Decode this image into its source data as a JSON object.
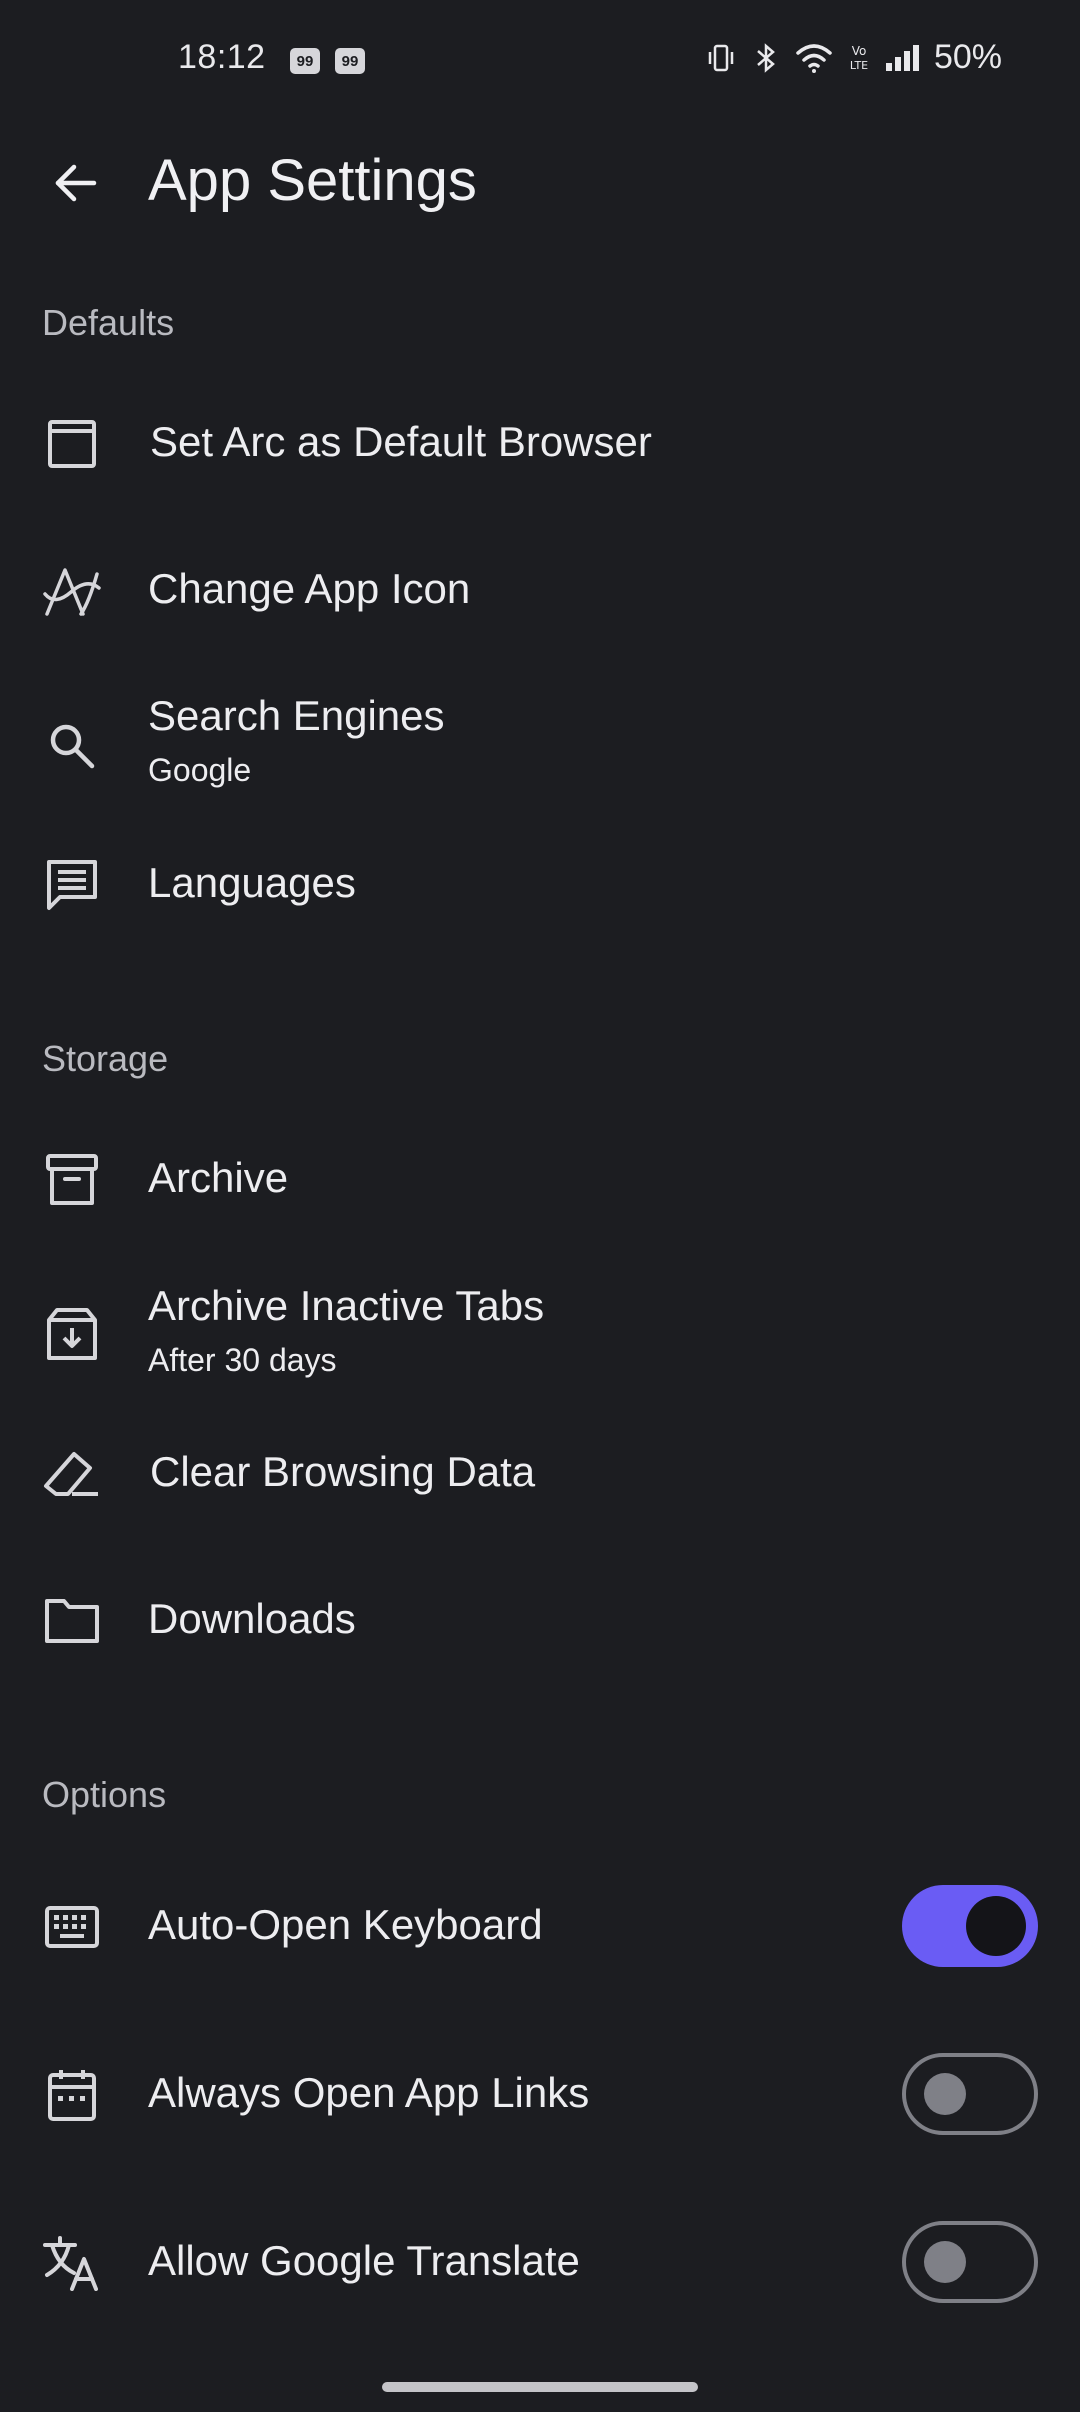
{
  "status_bar": {
    "time": "18:12",
    "notifications": [
      "99",
      "99"
    ],
    "icons": [
      "vibrate-icon",
      "bluetooth-icon",
      "wifi-icon",
      "volte-icon",
      "signal-icon"
    ],
    "volte_label": "Vo\nLTE",
    "battery": "50%"
  },
  "header": {
    "title": "App Settings",
    "back_icon": "back-arrow-icon"
  },
  "sections": {
    "defaults": {
      "title": "Defaults",
      "items": [
        {
          "label": "Set Arc as Default Browser",
          "icon": "browser-window-icon"
        },
        {
          "label": "Change App Icon",
          "icon": "arc-logo-icon"
        },
        {
          "label": "Search Engines",
          "sublabel": "Google",
          "icon": "search-icon"
        },
        {
          "label": "Languages",
          "icon": "message-icon"
        }
      ]
    },
    "storage": {
      "title": "Storage",
      "items": [
        {
          "label": "Archive",
          "icon": "archive-box-icon"
        },
        {
          "label": "Archive Inactive Tabs",
          "sublabel": "After 30 days",
          "icon": "archive-download-icon"
        },
        {
          "label": "Clear Browsing Data",
          "icon": "eraser-icon"
        },
        {
          "label": "Downloads",
          "icon": "folder-icon"
        }
      ]
    },
    "options": {
      "title": "Options",
      "items": [
        {
          "label": "Auto-Open Keyboard",
          "icon": "keyboard-icon",
          "enabled": true
        },
        {
          "label": "Always Open App Links",
          "icon": "calendar-icon",
          "enabled": false
        },
        {
          "label": "Allow Google Translate",
          "icon": "translate-icon",
          "enabled": false
        }
      ]
    }
  },
  "colors": {
    "background": "#1c1d21",
    "accent": "#6a5cf4",
    "text": "#ededf0",
    "muted": "#b9bac0"
  }
}
